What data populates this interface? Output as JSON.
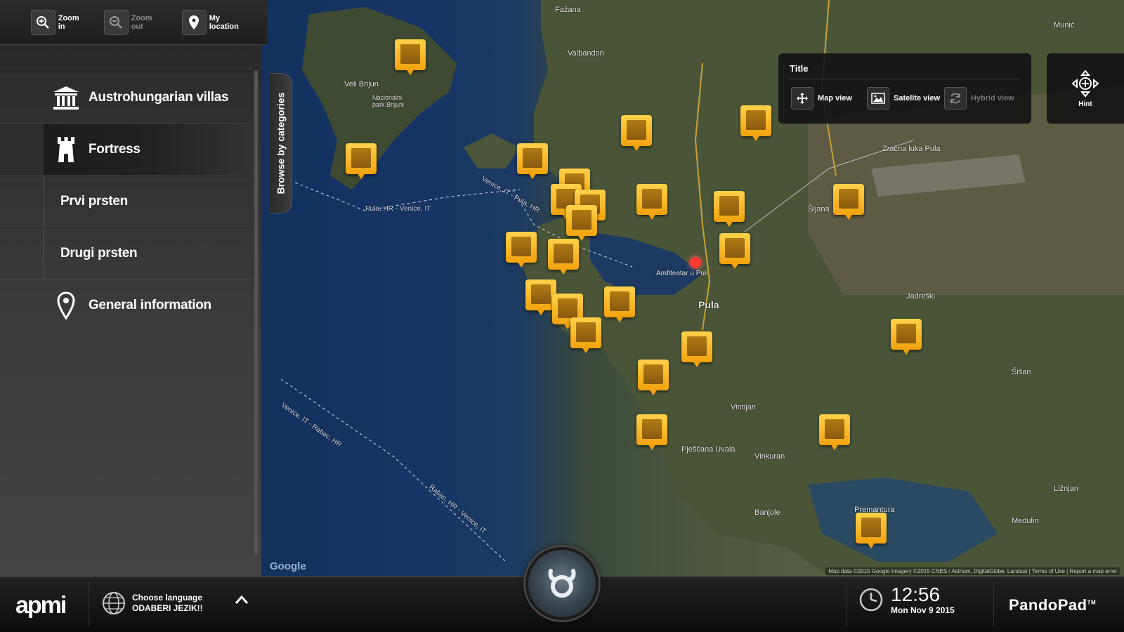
{
  "toolbar": {
    "zoom_in": "Zoom in",
    "zoom_out": "Zoom out",
    "my_location": "My location"
  },
  "sidebar": {
    "browse_tab": "Browse by categories",
    "items": [
      {
        "label": "Austrohungarian villas",
        "icon": "building-columns-icon",
        "state": "normal"
      },
      {
        "label": "Fortress",
        "icon": "fortress-tower-icon",
        "state": "active"
      },
      {
        "label": "Prvi prsten",
        "icon": "",
        "state": "sub"
      },
      {
        "label": "Drugi prsten",
        "icon": "",
        "state": "sub"
      },
      {
        "label": "General information",
        "icon": "location-pin-icon",
        "state": "plain"
      }
    ]
  },
  "view_panel": {
    "title": "Title",
    "map_view": "Map view",
    "satellite_view": "Satelite view",
    "hybrid_view": "Hybrid view"
  },
  "hint": {
    "label": "Hint"
  },
  "map": {
    "city_label": "Pula",
    "labels": [
      "Fažana",
      "Valbandon",
      "Nacionalni park Brijuni",
      "Veli Brijun",
      "Šijana",
      "Zračna luka Pula",
      "Jadreški",
      "Šišan",
      "Vintijan",
      "Vinkuran",
      "Pješčana Uvala",
      "Banjole",
      "Medulin",
      "Premantura",
      "Ližnjan",
      "Munić",
      "Amfiteatar u Puli"
    ],
    "route_labels": [
      "Pula, HR - Venice, IT",
      "Venice, IT - Pula, HR",
      "Venice, IT - Rabac, HR",
      "Rabac, HR - Venice, IT"
    ],
    "google": "Google",
    "attribution": "Map data ©2015 Google Imagery ©2015 CNES / Astrium, DigitalGlobe, Landsat | Terms of Use | Report a map error"
  },
  "bottombar": {
    "logo": "apmi",
    "language_title": "Choose language",
    "language_sub": "ODABERI JEZIK!!",
    "time": "12:56",
    "date": "Mon Nov 9 2015",
    "brand": "PandoPad",
    "brand_tm": "TM"
  },
  "colors": {
    "pin_top": "#ffd24a",
    "pin_bottom": "#f2a20e",
    "panel_dark": "#1e1e1e",
    "accent_red": "#ff3b2f"
  }
}
